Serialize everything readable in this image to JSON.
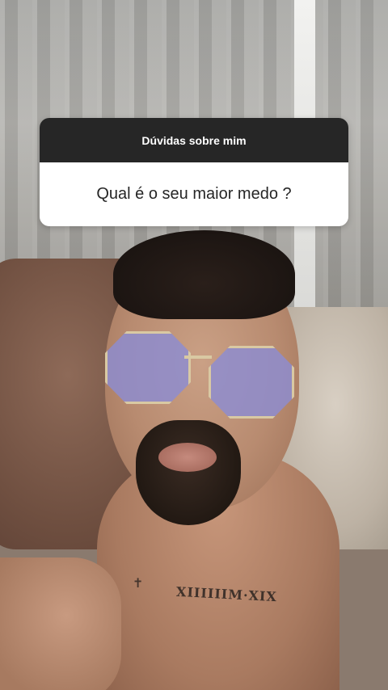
{
  "question_sticker": {
    "header": "Dúvidas sobre mim",
    "question": "Qual é o seu maior medo ?"
  },
  "photo": {
    "tattoo_text": "XIIIIIIM·XIX",
    "tattoo_cross": "✝"
  },
  "colors": {
    "sticker_header_bg": "#262626",
    "sticker_body_bg": "#ffffff",
    "lens_tint": "#8c8cd2"
  }
}
